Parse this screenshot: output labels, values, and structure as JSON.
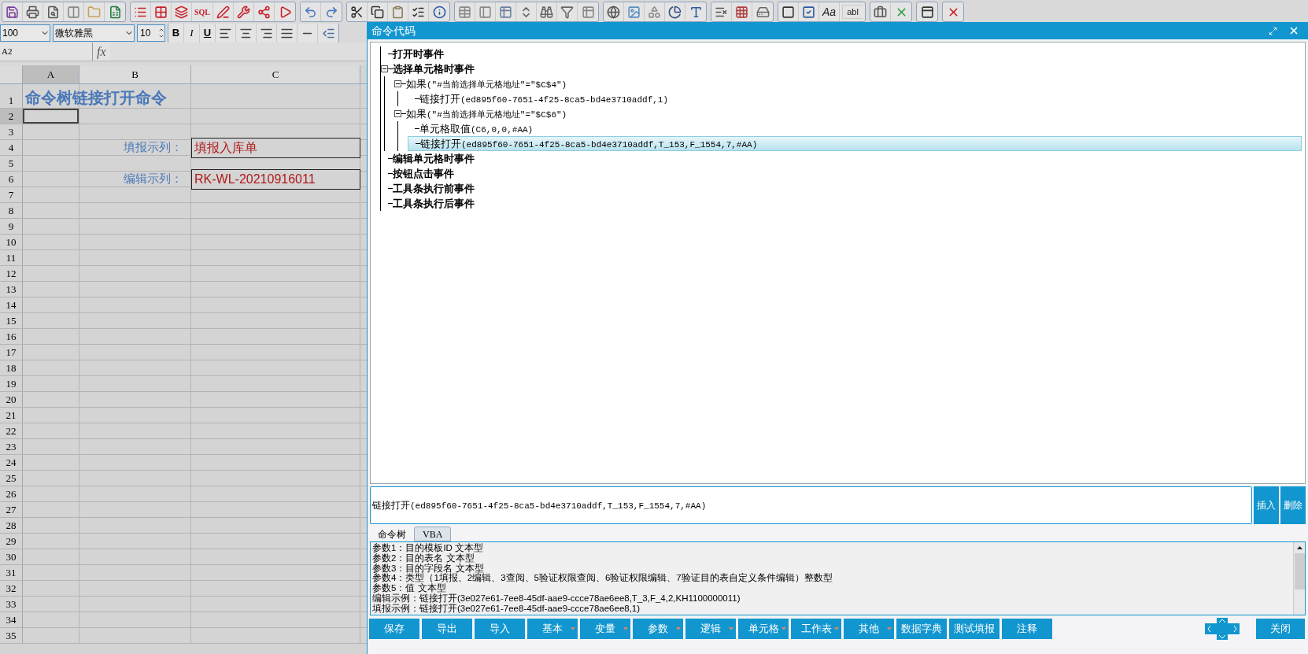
{
  "toolbar": {
    "sql": "SQL",
    "font_style": "Aa",
    "text_box": "abl"
  },
  "format_bar": {
    "zoom": "100",
    "font": "微软雅黑",
    "font_size": "10",
    "bold": "B",
    "italic": "I",
    "underline": "U"
  },
  "formula_bar": {
    "name_box": "A2",
    "fx": "fx"
  },
  "sheet": {
    "columns": [
      {
        "label": "A",
        "selected": true
      },
      {
        "label": "B",
        "selected": false
      },
      {
        "label": "C",
        "selected": false
      }
    ],
    "rows": [
      {
        "label": "1",
        "selected": false,
        "cells": [
          {
            "text": "命令树链接打开命令",
            "kind": "title"
          },
          null,
          null
        ]
      },
      {
        "label": "2",
        "selected": true,
        "cells": [
          null,
          null,
          null
        ]
      },
      {
        "label": "3",
        "selected": false,
        "cells": [
          null,
          null,
          null
        ]
      },
      {
        "label": "4",
        "selected": false,
        "cells": [
          null,
          {
            "text": "填报示列：",
            "kind": "label"
          },
          {
            "text": "填报入库单",
            "kind": "value"
          }
        ]
      },
      {
        "label": "5",
        "selected": false,
        "cells": [
          null,
          null,
          null
        ]
      },
      {
        "label": "6",
        "selected": false,
        "cells": [
          null,
          {
            "text": "编辑示列：",
            "kind": "label"
          },
          {
            "text": "RK-WL-20210916011",
            "kind": "value"
          }
        ]
      },
      {
        "label": "7",
        "selected": false
      },
      {
        "label": "8",
        "selected": false
      },
      {
        "label": "9",
        "selected": false
      },
      {
        "label": "10",
        "selected": false
      },
      {
        "label": "11",
        "selected": false
      },
      {
        "label": "12",
        "selected": false
      },
      {
        "label": "13",
        "selected": false
      },
      {
        "label": "14",
        "selected": false
      },
      {
        "label": "15",
        "selected": false
      },
      {
        "label": "16",
        "selected": false
      },
      {
        "label": "17",
        "selected": false
      },
      {
        "label": "18",
        "selected": false
      },
      {
        "label": "19",
        "selected": false
      },
      {
        "label": "20",
        "selected": false
      },
      {
        "label": "21",
        "selected": false
      },
      {
        "label": "22",
        "selected": false
      },
      {
        "label": "23",
        "selected": false
      },
      {
        "label": "24",
        "selected": false
      },
      {
        "label": "25",
        "selected": false
      },
      {
        "label": "26",
        "selected": false
      },
      {
        "label": "27",
        "selected": false
      },
      {
        "label": "28",
        "selected": false
      },
      {
        "label": "29",
        "selected": false
      },
      {
        "label": "30",
        "selected": false
      },
      {
        "label": "31",
        "selected": false
      },
      {
        "label": "32",
        "selected": false
      },
      {
        "label": "33",
        "selected": false
      },
      {
        "label": "34",
        "selected": false
      },
      {
        "label": "35",
        "selected": false
      }
    ]
  },
  "dialog": {
    "title": "命令代码",
    "tree": [
      {
        "name": "打开时事件",
        "selected": false
      },
      {
        "name": "选择单元格时事件",
        "selected": false,
        "expanded": true,
        "children": [
          {
            "name": "如果",
            "args": "(\"#当前选择单元格地址\"=\"$C$4\")",
            "selected": false,
            "expanded": true,
            "children": [
              {
                "name": "链接打开",
                "args": "(ed895f60-7651-4f25-8ca5-bd4e3710addf,1)",
                "selected": false
              }
            ]
          },
          {
            "name": "如果",
            "args": "(\"#当前选择单元格地址\"=\"$C$6\")",
            "selected": false,
            "expanded": true,
            "children": [
              {
                "name": "单元格取值",
                "args": "(C6,0,0,#AA)",
                "selected": false
              },
              {
                "name": "链接打开",
                "args": "(ed895f60-7651-4f25-8ca5-bd4e3710addf,T_153,F_1554,7,#AA)",
                "selected": true
              }
            ]
          }
        ]
      },
      {
        "name": "编辑单元格时事件",
        "selected": false
      },
      {
        "name": "按钮点击事件",
        "selected": false
      },
      {
        "name": "工具条执行前事件",
        "selected": false
      },
      {
        "name": "工具条执行后事件",
        "selected": false
      }
    ],
    "editor": {
      "name": "链接打开",
      "args": "(ed895f60-7651-4f25-8ca5-bd4e3710addf,T_153,F_1554,7,#AA)"
    },
    "insert_button": "插入",
    "delete_button": "删除",
    "tabs": [
      {
        "label": "命令树",
        "selected": true
      },
      {
        "label": "VBA",
        "selected": false
      }
    ],
    "help_lines": [
      "参数1：目的模板ID 文本型",
      "参数2：目的表名 文本型",
      "参数3：目的字段名 文本型",
      "参数4：类型（1填报、2编辑、3查阅、5验证权限查阅、6验证权限编辑、7验证目的表自定义条件编辑）整数型",
      "参数5：值 文本型",
      "编辑示例：链接打开(3e027e61-7ee8-45df-aae9-ccce78ae6ee8,T_3,F_4,2,KH1100000011)",
      "填报示例：链接打开(3e027e61-7ee8-45df-aae9-ccce78ae6ee8,1)"
    ],
    "buttons": [
      {
        "label": "保存",
        "kind": "plain"
      },
      {
        "label": "导出",
        "kind": "plain"
      },
      {
        "label": "导入",
        "kind": "plain"
      },
      {
        "label": "基本",
        "kind": "dropdown"
      },
      {
        "label": "变量",
        "kind": "dropdown"
      },
      {
        "label": "参数",
        "kind": "dropdown"
      },
      {
        "label": "逻辑",
        "kind": "dropdown"
      },
      {
        "label": "单元格",
        "kind": "dropdown"
      },
      {
        "label": "工作表",
        "kind": "dropdown"
      },
      {
        "label": "其他",
        "kind": "dropdown"
      },
      {
        "label": "数据字典",
        "kind": "plain"
      },
      {
        "label": "测试填报",
        "kind": "plain"
      },
      {
        "label": "注释",
        "kind": "plain"
      }
    ],
    "close_button": "关闭"
  }
}
